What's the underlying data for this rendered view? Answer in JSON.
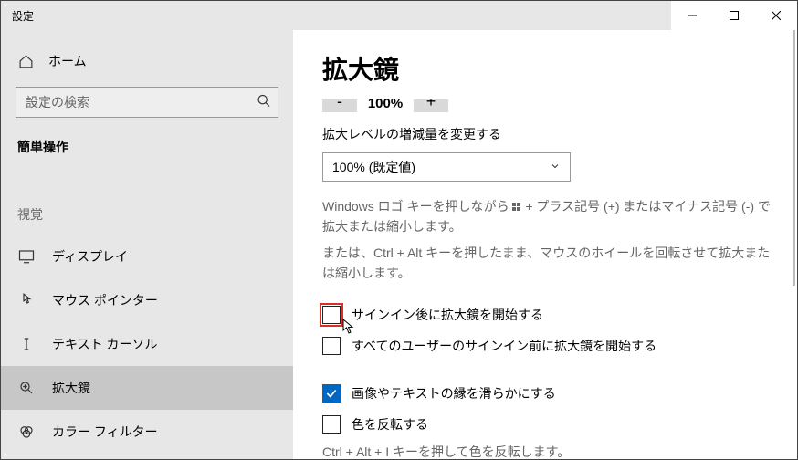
{
  "window": {
    "title": "設定"
  },
  "sidebar": {
    "home_label": "ホーム",
    "search_placeholder": "設定の検索",
    "section_label": "簡単操作",
    "group_header": "視覚",
    "items": [
      {
        "label": "ディスプレイ"
      },
      {
        "label": "マウス ポインター"
      },
      {
        "label": "テキスト カーソル"
      },
      {
        "label": "拡大鏡"
      },
      {
        "label": "カラー フィルター"
      }
    ]
  },
  "main": {
    "title": "拡大鏡",
    "zoom": {
      "minus": "-",
      "value": "100%",
      "plus": "+"
    },
    "increment_label": "拡大レベルの増減量を変更する",
    "select_value": "100% (既定値)",
    "hint1_pre": "Windows ロゴ キーを押しながら ",
    "hint1_post": " + プラス記号 (+) またはマイナス記号 (-) で拡大または縮小します。",
    "hint2": "または、Ctrl + Alt キーを押したまま、マウスのホイールを回転させて拡大または縮小します。",
    "checks": [
      {
        "label": "サインイン後に拡大鏡を開始する"
      },
      {
        "label": "すべてのユーザーのサインイン前に拡大鏡を開始する"
      },
      {
        "label": "画像やテキストの縁を滑らかにする"
      },
      {
        "label": "色を反転する"
      }
    ],
    "invert_hint": "Ctrl + Alt + I キーを押して色を反転します。"
  }
}
